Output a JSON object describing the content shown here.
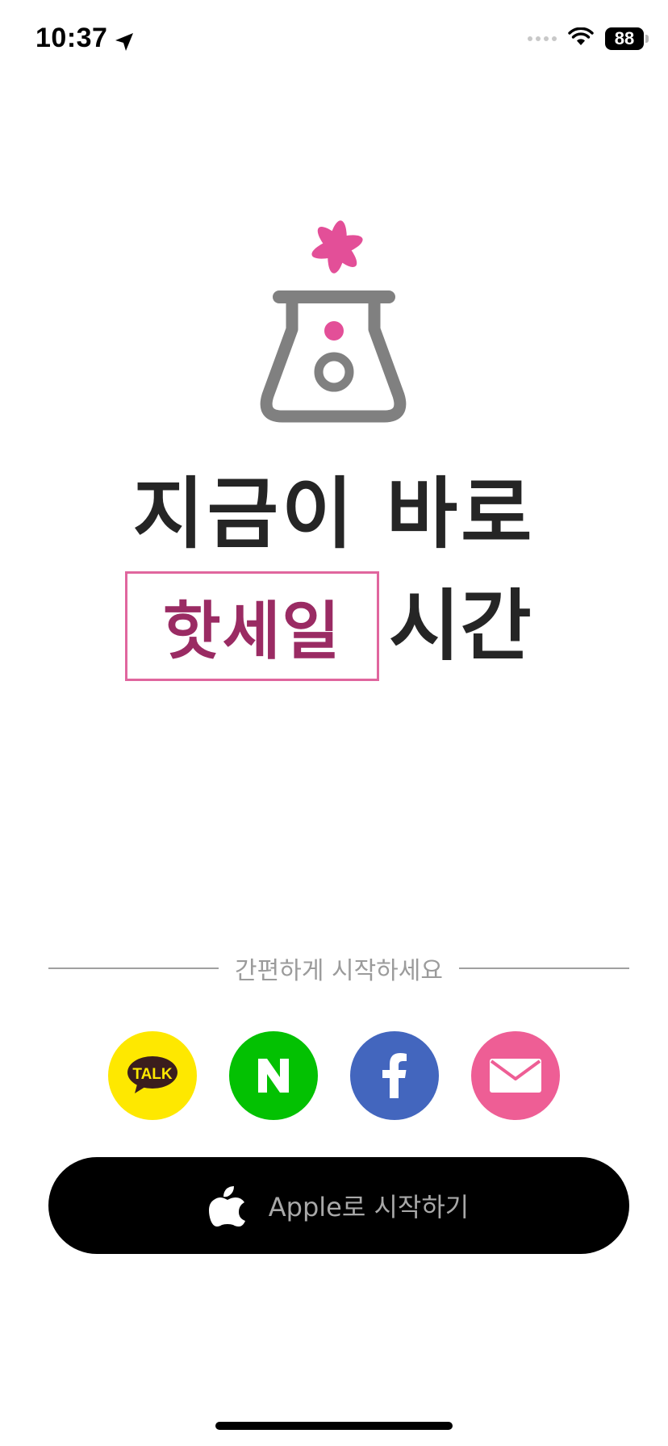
{
  "status_bar": {
    "time": "10:37",
    "battery": "88"
  },
  "headline": {
    "line1": "지금이 바로",
    "highlight": "핫세일",
    "line2_suffix": "시간"
  },
  "divider": {
    "text": "간편하게 시작하세요"
  },
  "social": {
    "kakao_label": "TALK",
    "naver_label": "N",
    "facebook_label": "f"
  },
  "apple_button": {
    "label": "Apple로 시작하기"
  },
  "colors": {
    "brand_pink": "#e34f98",
    "highlight_text": "#9a2b63",
    "flask_gray": "#808080",
    "kakao": "#fee800",
    "naver": "#03c102",
    "facebook": "#4366be",
    "email": "#ee5e95"
  }
}
